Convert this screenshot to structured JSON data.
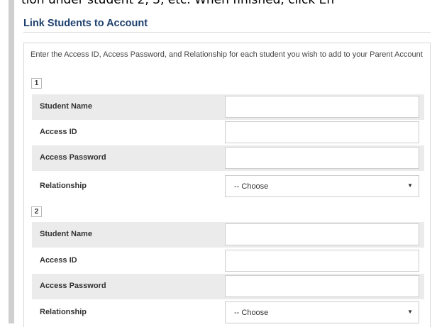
{
  "header": {
    "instruction": "tion under student 2, 3, etc. When finished, click En"
  },
  "panel": {
    "title": "Link Students to Account",
    "intro": "Enter the Access ID, Access Password, and Relationship for each student you wish to add to your Parent Account"
  },
  "students": [
    {
      "number": "1",
      "student_name_label": "Student Name",
      "access_id_label": "Access ID",
      "access_password_label": "Access Password",
      "relationship_label": "Relationship",
      "student_name_value": "",
      "access_id_value": "",
      "access_password_value": "",
      "relationship_selected": "-- Choose"
    },
    {
      "number": "2",
      "student_name_label": "Student Name",
      "access_id_label": "Access ID",
      "access_password_label": "Access Password",
      "relationship_label": "Relationship",
      "student_name_value": "",
      "access_id_value": "",
      "access_password_value": "",
      "relationship_selected": "-- Choose"
    }
  ]
}
